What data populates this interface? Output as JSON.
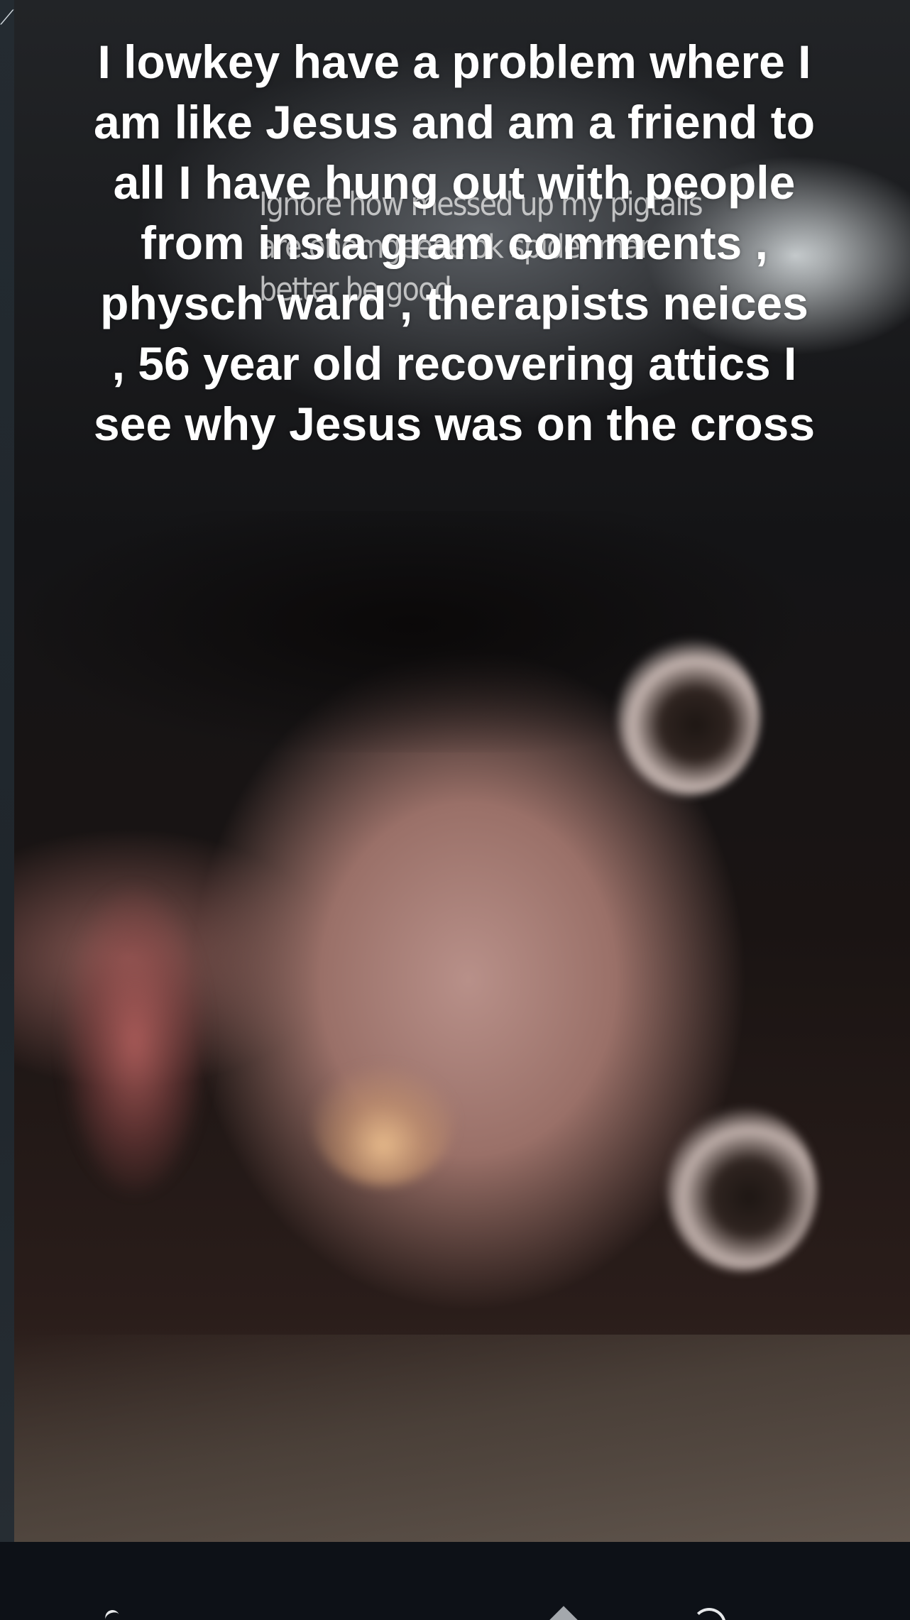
{
  "caption": {
    "main": "I lowkey have a problem where I am like Jesus and am a friend to all I have hung out with people from insta gram comments , physch ward , therapists neices , 56 year old recovering attics I see why Jesus was on the cross",
    "overlay": "Ignore how messed up my pigtails are ohemgeeee ok spider man better be good"
  },
  "nav": {
    "back_icon": "back-arrow-icon",
    "home_icon": "home-icon",
    "rotate_icon": "rotate-icon"
  },
  "colors": {
    "background": "#0d1117",
    "caption_text": "#ffffff"
  }
}
